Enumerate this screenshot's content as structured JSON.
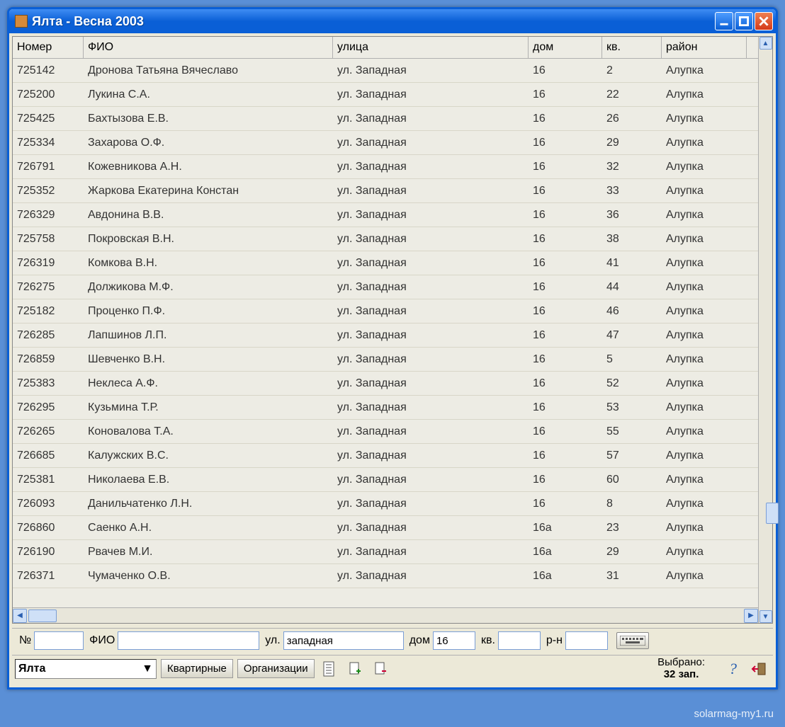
{
  "window": {
    "title": "Ялта  - Весна 2003"
  },
  "columns": {
    "number": "Номер",
    "fio": "ФИО",
    "street": "улица",
    "house": "дом",
    "apt": "кв.",
    "district": "район"
  },
  "rows": [
    {
      "num": "725142",
      "fio": "Дронова Татьяна Вячеславо",
      "street": "ул. Западная",
      "house": "16",
      "apt": "2",
      "dist": "Алупка"
    },
    {
      "num": "725200",
      "fio": "Лукина С.А.",
      "street": "ул. Западная",
      "house": "16",
      "apt": "22",
      "dist": "Алупка"
    },
    {
      "num": "725425",
      "fio": "Бахтызова Е.В.",
      "street": "ул. Западная",
      "house": "16",
      "apt": "26",
      "dist": "Алупка"
    },
    {
      "num": "725334",
      "fio": "Захарова О.Ф.",
      "street": "ул. Западная",
      "house": "16",
      "apt": "29",
      "dist": "Алупка"
    },
    {
      "num": "726791",
      "fio": "Кожевникова А.Н.",
      "street": "ул. Западная",
      "house": "16",
      "apt": "32",
      "dist": "Алупка"
    },
    {
      "num": "725352",
      "fio": "Жаркова Екатерина Констан",
      "street": "ул. Западная",
      "house": "16",
      "apt": "33",
      "dist": "Алупка"
    },
    {
      "num": "726329",
      "fio": "Авдонина В.В.",
      "street": "ул. Западная",
      "house": "16",
      "apt": "36",
      "dist": "Алупка"
    },
    {
      "num": "725758",
      "fio": "Покровская В.Н.",
      "street": "ул. Западная",
      "house": "16",
      "apt": "38",
      "dist": "Алупка"
    },
    {
      "num": "726319",
      "fio": "Комкова В.Н.",
      "street": "ул. Западная",
      "house": "16",
      "apt": "41",
      "dist": "Алупка"
    },
    {
      "num": "726275",
      "fio": "Должикова М.Ф.",
      "street": "ул. Западная",
      "house": "16",
      "apt": "44",
      "dist": "Алупка"
    },
    {
      "num": "725182",
      "fio": "Проценко П.Ф.",
      "street": "ул. Западная",
      "house": "16",
      "apt": "46",
      "dist": "Алупка"
    },
    {
      "num": "726285",
      "fio": "Лапшинов Л.П.",
      "street": "ул. Западная",
      "house": "16",
      "apt": "47",
      "dist": "Алупка"
    },
    {
      "num": "726859",
      "fio": "Шевченко В.Н.",
      "street": "ул. Западная",
      "house": "16",
      "apt": "5",
      "dist": "Алупка"
    },
    {
      "num": "725383",
      "fio": "Неклеса А.Ф.",
      "street": "ул. Западная",
      "house": "16",
      "apt": "52",
      "dist": "Алупка"
    },
    {
      "num": "726295",
      "fio": "Кузьмина Т.Р.",
      "street": "ул. Западная",
      "house": "16",
      "apt": "53",
      "dist": "Алупка"
    },
    {
      "num": "726265",
      "fio": "Коновалова Т.А.",
      "street": "ул. Западная",
      "house": "16",
      "apt": "55",
      "dist": "Алупка"
    },
    {
      "num": "726685",
      "fio": "Калужских В.С.",
      "street": "ул. Западная",
      "house": "16",
      "apt": "57",
      "dist": "Алупка"
    },
    {
      "num": "725381",
      "fio": "Николаева Е.В.",
      "street": "ул. Западная",
      "house": "16",
      "apt": "60",
      "dist": "Алупка"
    },
    {
      "num": "726093",
      "fio": "Данильчатенко Л.Н.",
      "street": "ул. Западная",
      "house": "16",
      "apt": "8",
      "dist": "Алупка"
    },
    {
      "num": "726860",
      "fio": "Саенко А.Н.",
      "street": "ул. Западная",
      "house": "16а",
      "apt": "23",
      "dist": "Алупка"
    },
    {
      "num": "726190",
      "fio": "Рвачев М.И.",
      "street": "ул. Западная",
      "house": "16а",
      "apt": "29",
      "dist": "Алупка"
    },
    {
      "num": "726371",
      "fio": "Чумаченко О.В.",
      "street": "ул. Западная",
      "house": "16а",
      "apt": "31",
      "dist": "Алупка"
    }
  ],
  "filter": {
    "num_label": "№",
    "fio_label": "ФИО",
    "street_label": "ул.",
    "house_label": "дом",
    "apt_label": "кв.",
    "district_label": "р-н",
    "num_value": "",
    "fio_value": "",
    "street_value": "западная",
    "house_value": "16",
    "apt_value": "",
    "district_value": ""
  },
  "toolbar": {
    "city": "Ялта",
    "btn1": "Квартирные",
    "btn2": "Организации",
    "status_line1": "Выбрано:",
    "status_line2": "32 зап."
  },
  "watermark": "solarmag-my1.ru"
}
